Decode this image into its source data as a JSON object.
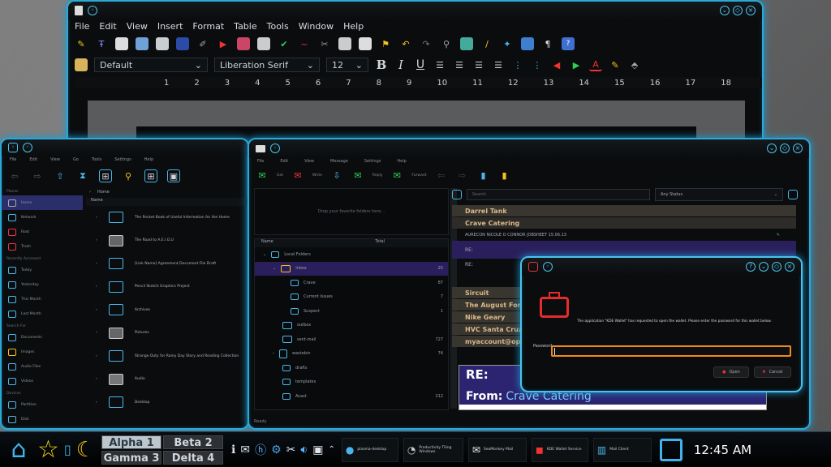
{
  "writer": {
    "title": "",
    "menu": [
      "File",
      "Edit",
      "View",
      "Insert",
      "Format",
      "Table",
      "Tools",
      "Window",
      "Help"
    ],
    "style": "Default",
    "font": "Liberation Serif",
    "size": "12",
    "ruler": [
      "1",
      "2",
      "3",
      "4",
      "5",
      "6",
      "7",
      "8",
      "9",
      "10",
      "11",
      "12",
      "13",
      "14",
      "15",
      "16",
      "17",
      "18"
    ]
  },
  "filemanager": {
    "menu": [
      "File",
      "Edit",
      "View",
      "Go",
      "Tools",
      "Settings",
      "Help"
    ],
    "places_header": "Places",
    "places": [
      "Home",
      "Network",
      "Root",
      "Trash",
      "Recently Accessed"
    ],
    "recent_header": "Recently Accessed",
    "recent": [
      "Today",
      "Yesterday",
      "This Month",
      "Last Month"
    ],
    "search_header": "Search For",
    "search": [
      "Documents",
      "Images",
      "Audio Files",
      "Videos"
    ],
    "devices_header": "Devices",
    "devices": [
      "Partition",
      "Disk"
    ],
    "crumb": "Home",
    "col_name": "Name",
    "rows": [
      "The Pocket Book of Useful Information for the Home",
      "The Road to A.E.I.O.U",
      "[Link Name] Agreement Document File Draft",
      "Pencil Sketch Graphics Project",
      "Archives",
      "Pictures",
      "Strange Duty for Rainy Day Story and Reading Collection",
      "Audio",
      "Desktop"
    ]
  },
  "mail": {
    "menu": [
      "File",
      "Edit",
      "View",
      "Message",
      "Settings",
      "Help"
    ],
    "toolbar": [
      "Get",
      "Write",
      "Reply",
      "Forward"
    ],
    "favorites_hint": "Drop your favorite folders here...",
    "col_name": "Name",
    "col_total": "Total",
    "folders": [
      {
        "name": "Local Folders",
        "count": ""
      },
      {
        "name": "Inbox",
        "count": "20"
      },
      {
        "name": "Crave",
        "count": "87"
      },
      {
        "name": "Current Issues",
        "count": "7"
      },
      {
        "name": "Suspect",
        "count": "1"
      },
      {
        "name": "outbox",
        "count": ""
      },
      {
        "name": "sent-mail",
        "count": "727"
      },
      {
        "name": "wastebin",
        "count": "74"
      },
      {
        "name": "drafts",
        "count": ""
      },
      {
        "name": "templates",
        "count": ""
      },
      {
        "name": "Avast",
        "count": "212"
      }
    ],
    "search_placeholder": "Search",
    "filter": "Any Status",
    "groups_top": [
      "Darrel Tank",
      "Crave Catering"
    ],
    "messages": [
      "AURECON NICOLE O CONNOR JOBSHEET 15.06.13",
      "RE:",
      "RE:"
    ],
    "groups_bottom": [
      "Sircuit",
      "The August Force",
      "Nike Geary",
      "HVC Santa Cruz",
      "myaccount@optu"
    ],
    "preview_subject": "RE:",
    "preview_from_label": "From:",
    "preview_from": "Crave Catering",
    "status": "Ready"
  },
  "dialog": {
    "title": "",
    "message": "The application \"KDE Wallet\" has requested to open the wallet. Please enter the password for this wallet below.",
    "password_label": "Password:",
    "ok": "Open",
    "cancel": "Cancel"
  },
  "taskbar": {
    "desktops": [
      "Alpha 1",
      "Beta 2",
      "Gamma 3",
      "Delta 4"
    ],
    "tasks": [
      "plasma-desktop",
      "Productivity Tiling Windows",
      "SeaMonkey Mail",
      "KDE Wallet Service",
      "Mail Client"
    ],
    "clock": "12:45 AM"
  }
}
